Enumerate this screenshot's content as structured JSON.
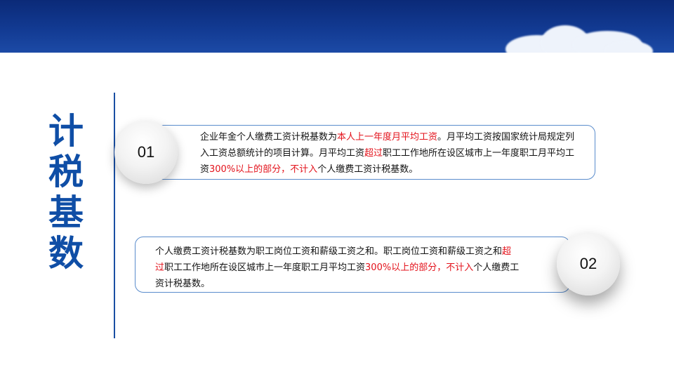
{
  "title_chars": [
    "计",
    "税",
    "基",
    "数"
  ],
  "item1": {
    "number": "01",
    "segments": [
      {
        "text": "企业年金个人缴费工资计税基数为",
        "red": false
      },
      {
        "text": "本人上一年度月平均工资",
        "red": true
      },
      {
        "text": "。月平均工资按国家统计局规定列入工资总额统计的项目计算。月平均工资",
        "red": false
      },
      {
        "text": "超过",
        "red": true
      },
      {
        "text": "职工工作地所在设区城市上一年度职工月平均工资",
        "red": false
      },
      {
        "text": "300%以上的部分，不计入",
        "red": true
      },
      {
        "text": "个人缴费工资计税基数。",
        "red": false
      }
    ]
  },
  "item2": {
    "number": "02",
    "segments": [
      {
        "text": "个人缴费工资计税基数为职工岗位工资和薪级工资之和。职工岗位工资和薪级工资之和",
        "red": false
      },
      {
        "text": "超过",
        "red": true
      },
      {
        "text": "职工工作地所在设区城市上一年度职工月平均工资",
        "red": false
      },
      {
        "text": "300%以上的部分，不计入",
        "red": true
      },
      {
        "text": "个人缴费工资计税基数。",
        "red": false
      }
    ]
  },
  "colors": {
    "banner": "#123a92",
    "title": "#0f4ea6",
    "highlight": "#e3121b",
    "border": "#5a8ccc"
  }
}
